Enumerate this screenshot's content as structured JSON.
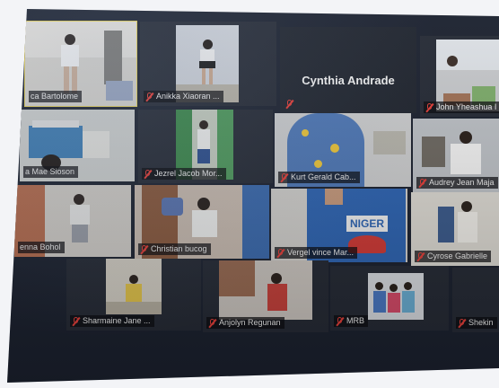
{
  "meeting": {
    "participants": [
      {
        "label": "ca Bartolome",
        "muted": false,
        "active": true
      },
      {
        "label": "Anikka Xiaoran ...",
        "muted": true
      },
      {
        "label": "Cynthia Andrade",
        "muted": true,
        "video_off": true
      },
      {
        "label": "John Yheashua I",
        "muted": true
      },
      {
        "label": "a Mae Sioson",
        "muted": false
      },
      {
        "label": "Jezrel Jacob Mor...",
        "muted": true
      },
      {
        "label": "Kurt Gerald Cab...",
        "muted": true
      },
      {
        "label": "Audrey Jean Maja",
        "muted": true
      },
      {
        "label": "enna Bohol",
        "muted": false
      },
      {
        "label": "Christian bucog",
        "muted": true
      },
      {
        "label": "Vergel vince Mar...",
        "muted": true
      },
      {
        "label": "Cyrose Gabrielle",
        "muted": true
      },
      {
        "label": "Sharmaine Jane ...",
        "muted": true
      },
      {
        "label": "Anjolyn Regunan",
        "muted": true
      },
      {
        "label": "MRB",
        "muted": true
      },
      {
        "label": "Shekin",
        "muted": true
      }
    ],
    "shirt_text": "NIGER",
    "colors": {
      "active_speaker_border": "#e8d460",
      "muted_icon": "#e8403a",
      "tile_bg": "#262b36"
    }
  }
}
